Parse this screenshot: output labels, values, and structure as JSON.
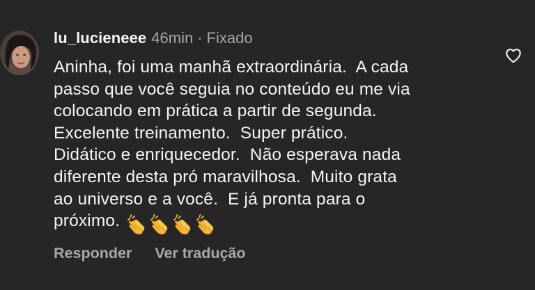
{
  "comment": {
    "username": "lu_lucieneee",
    "time": "46min",
    "separator": "·",
    "pinned_label": "Fixado",
    "text_lines": [
      "Aninha, foi uma manhã extraordinária.  A cada",
      "passo que você seguia no conteúdo eu me via",
      "colocando em prática a partir de segunda.",
      "Excelente treinamento.  Super prático.",
      "Didático e enriquecedor.  Não esperava nada",
      "diferente desta pró maravilhosa.  Muito grata",
      "ao universo e a você.  E já pronta para o",
      "próximo."
    ],
    "emojis": [
      "clapping-hands",
      "clapping-hands",
      "clapping-hands",
      "clapping-hands"
    ],
    "actions": {
      "reply_label": "Responder",
      "translate_label": "Ver tradução"
    },
    "like_icon": "heart-outline-icon"
  },
  "colors": {
    "background": "#262626",
    "primary_text": "#f5f5f5",
    "secondary_text": "#a8a8a8"
  }
}
